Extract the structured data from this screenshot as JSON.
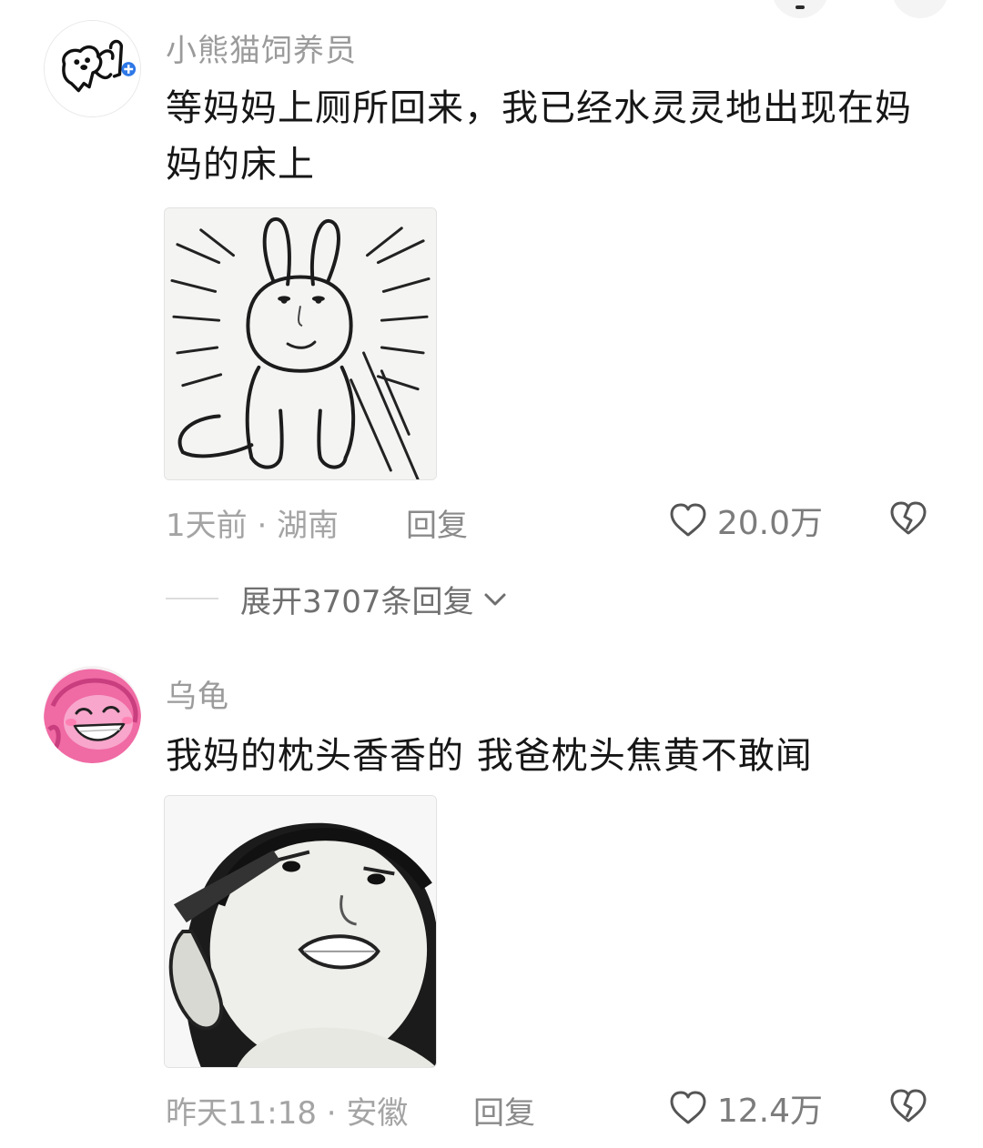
{
  "comments": [
    {
      "username": "小熊猫饲养员",
      "text": "等妈妈上厕所回来，我已经水灵灵地出现在妈妈的床上",
      "meta": "1天前 · 湖南",
      "reply_label": "回复",
      "likes": "20.0万",
      "avatar_icon": "cartoon-dog-avatar",
      "sticker_icon": "sketch-bunny-sticker"
    },
    {
      "username": "乌龟",
      "text": "我妈的枕头香香的 我爸枕头焦黄不敢闻",
      "meta": "昨天11:18 · 安徽",
      "reply_label": "回复",
      "likes": "12.4万",
      "avatar_icon": "pink-pony-avatar",
      "sticker_icon": "meme-face-salute-sticker"
    }
  ],
  "expand_replies": {
    "label": "展开3707条回复"
  },
  "colors": {
    "text_primary": "#161616",
    "text_secondary": "#9b9b9b",
    "pink_avatar": "#f06aa4"
  }
}
